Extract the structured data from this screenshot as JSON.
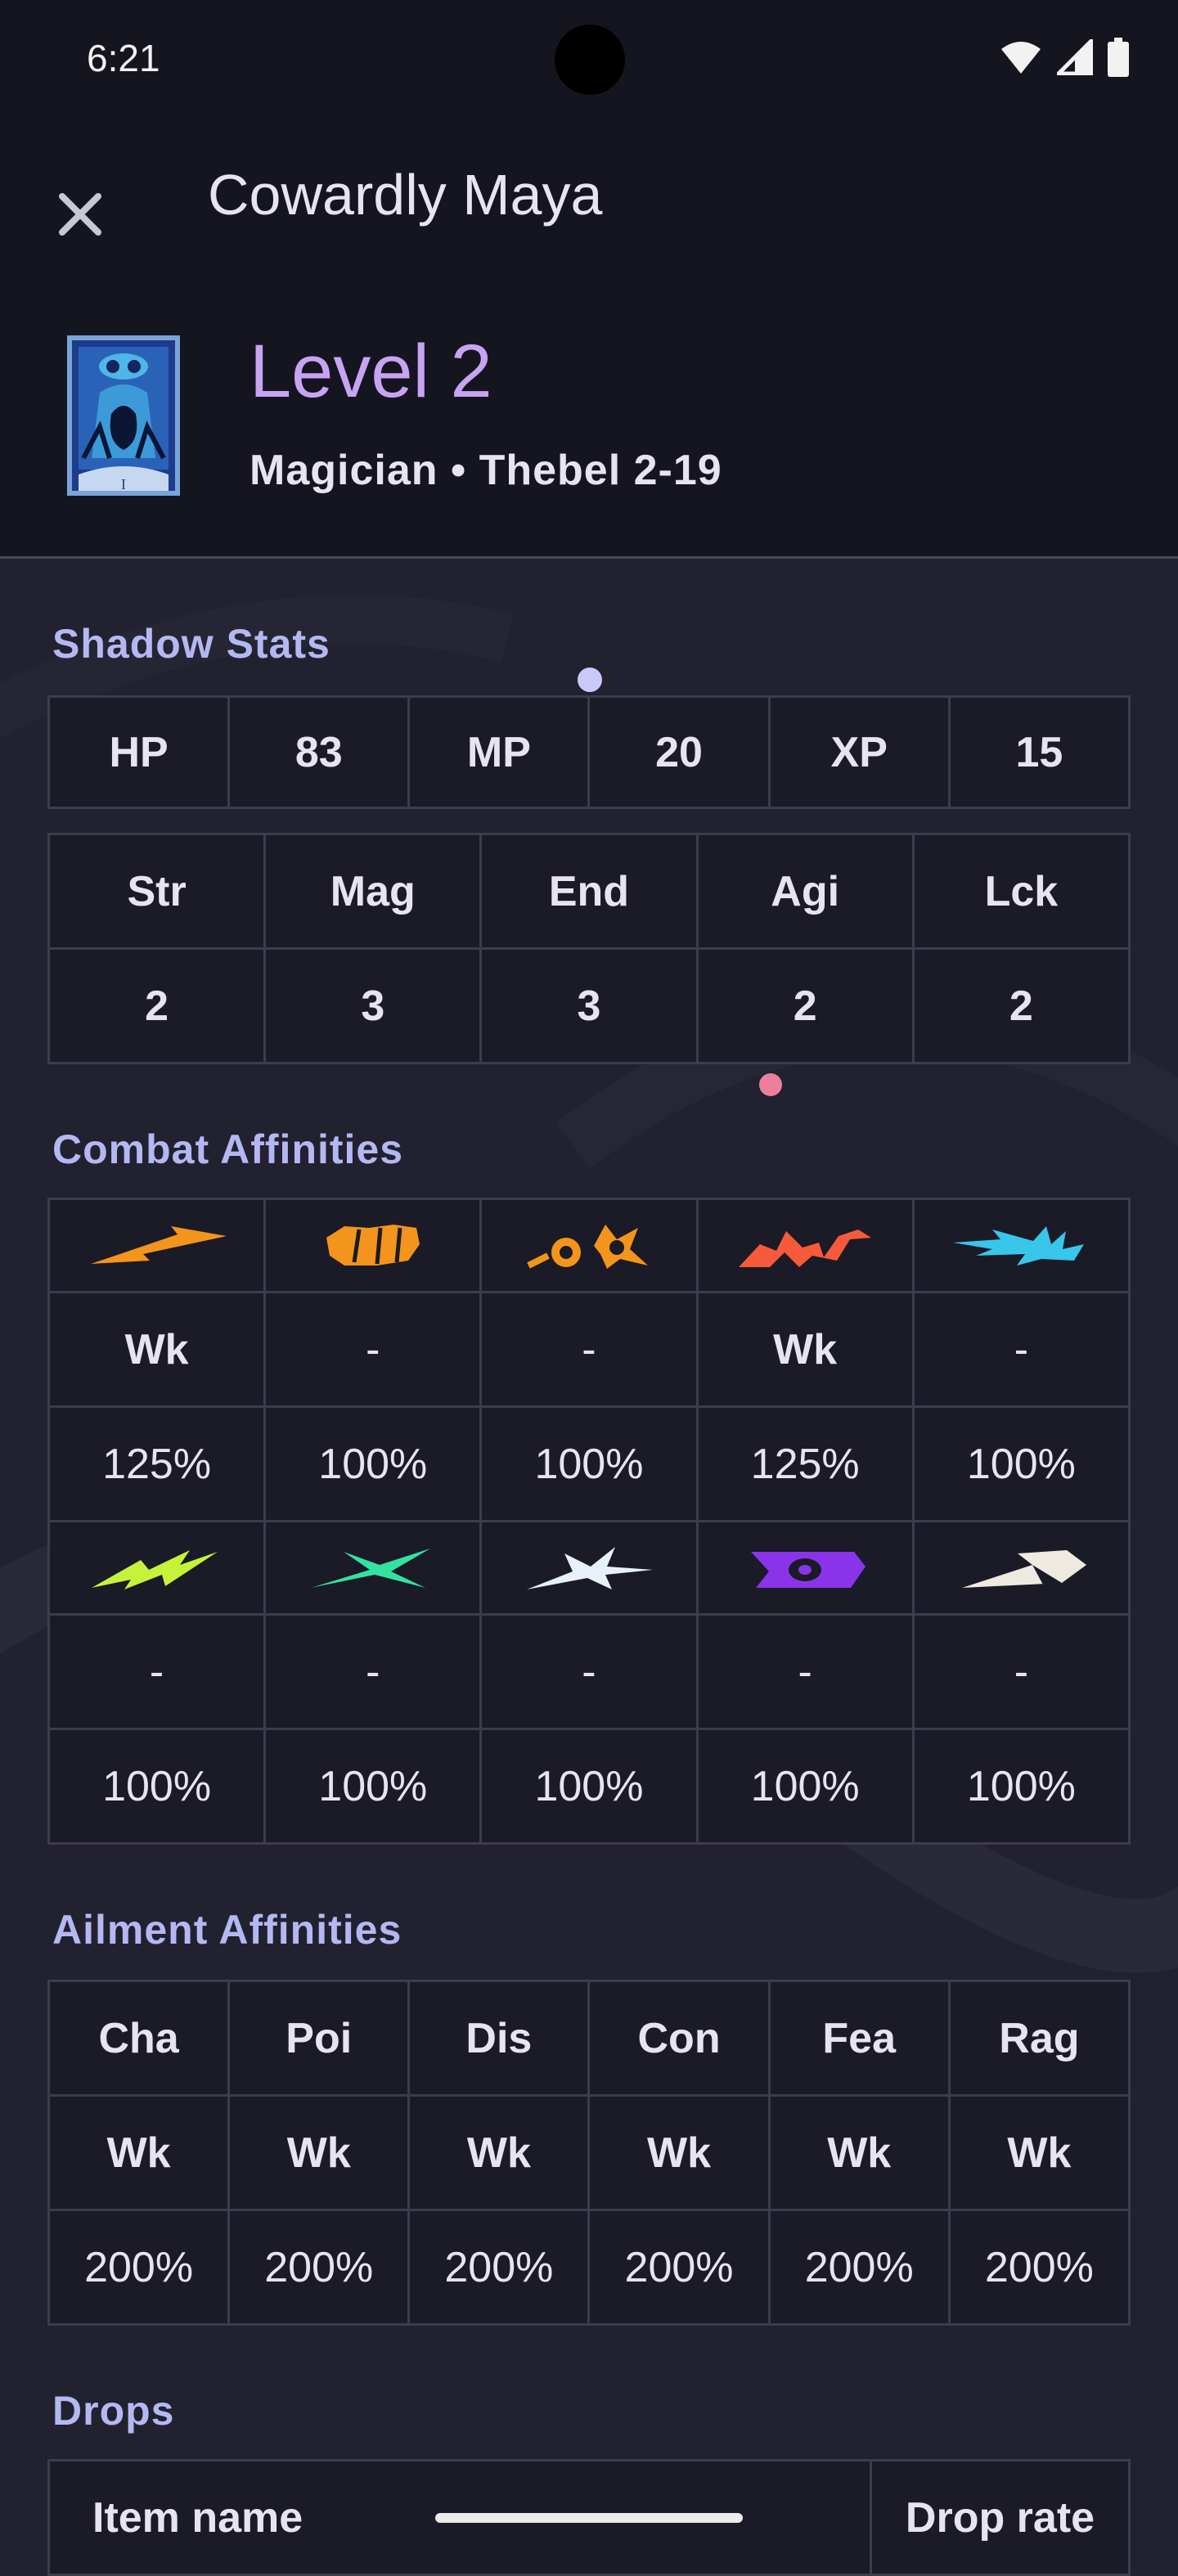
{
  "status_bar": {
    "time": "6:21",
    "icons": [
      "wifi-icon",
      "signal-icon",
      "battery-icon"
    ]
  },
  "header": {
    "close_icon": "close-icon",
    "title": "Cowardly Maya",
    "level": "Level 2",
    "subtitle": "Magician • Thebel 2-19",
    "card_icon": "magician-tarot-card-icon",
    "card_numeral": "I"
  },
  "colors": {
    "accent_purple": "#c7a4f2",
    "section_title": "#b4b8f2",
    "weak": "#ee7f9c",
    "background": "#22212f"
  },
  "shadow_stats": {
    "title": "Shadow Stats",
    "row1": [
      "HP",
      "83",
      "MP",
      "20",
      "XP",
      "15"
    ],
    "stat_headers": [
      "Str",
      "Mag",
      "End",
      "Agi",
      "Lck"
    ],
    "stat_values": [
      "2",
      "3",
      "3",
      "2",
      "2"
    ]
  },
  "combat_affinities": {
    "title": "Combat Affinities",
    "row1_icons": [
      "slash-icon",
      "strike-icon",
      "pierce-icon",
      "fire-icon",
      "ice-icon"
    ],
    "row1_affinity": [
      "Wk",
      "-",
      "-",
      "Wk",
      "-"
    ],
    "row1_multiplier": [
      "125%",
      "100%",
      "100%",
      "125%",
      "100%"
    ],
    "row2_icons": [
      "electric-icon",
      "wind-icon",
      "almighty-icon",
      "dark-icon",
      "light-icon"
    ],
    "row2_affinity": [
      "-",
      "-",
      "-",
      "-",
      "-"
    ],
    "row2_multiplier": [
      "100%",
      "100%",
      "100%",
      "100%",
      "100%"
    ]
  },
  "ailment_affinities": {
    "title": "Ailment Affinities",
    "headers": [
      "Cha",
      "Poi",
      "Dis",
      "Con",
      "Fea",
      "Rag"
    ],
    "affinity": [
      "Wk",
      "Wk",
      "Wk",
      "Wk",
      "Wk",
      "Wk"
    ],
    "multiplier": [
      "200%",
      "200%",
      "200%",
      "200%",
      "200%",
      "200%"
    ]
  },
  "drops": {
    "title": "Drops",
    "col_item": "Item name",
    "col_rate": "Drop rate"
  }
}
